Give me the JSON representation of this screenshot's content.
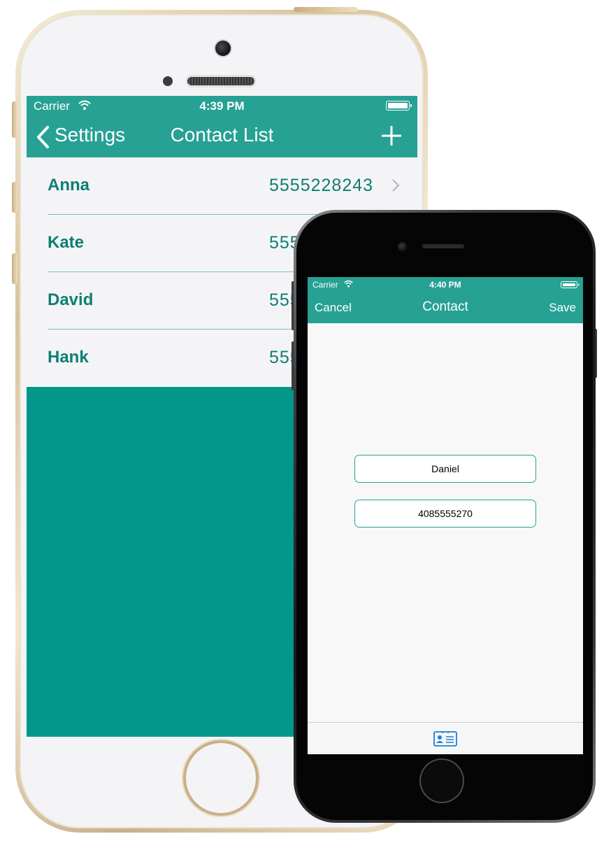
{
  "back_phone": {
    "status": {
      "carrier": "Carrier",
      "time": "4:39 PM"
    },
    "nav": {
      "back_label": "Settings",
      "title": "Contact List",
      "add_icon": "plus-icon"
    },
    "contacts": [
      {
        "name": "Anna",
        "phone": "5555228243"
      },
      {
        "name": "Kate",
        "phone": "555"
      },
      {
        "name": "David",
        "phone": "555"
      },
      {
        "name": "Hank",
        "phone": "555"
      }
    ],
    "colors": {
      "nav": "#26a193",
      "accent_text": "#0c7f72",
      "background": "#03968a"
    }
  },
  "front_phone": {
    "status": {
      "carrier": "Carrier",
      "time": "4:40 PM"
    },
    "nav": {
      "cancel_label": "Cancel",
      "title": "Contact",
      "save_label": "Save"
    },
    "form": {
      "name_value": "Daniel",
      "phone_value": "4085555270"
    },
    "tabbar": {
      "icon": "contact-card-icon"
    }
  }
}
